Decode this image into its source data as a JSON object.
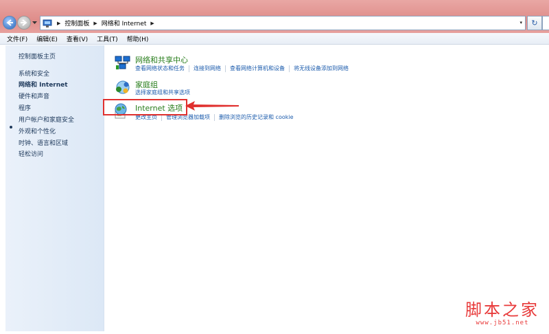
{
  "address": {
    "breadcrumb": [
      "控制面板",
      "网络和 Internet"
    ],
    "dropdown_glyph": "▾",
    "refresh_glyph": "↻"
  },
  "menu": [
    "文件(F)",
    "编辑(E)",
    "查看(V)",
    "工具(T)",
    "帮助(H)"
  ],
  "sidebar": {
    "items": [
      {
        "label": "控制面板主页",
        "active": false
      },
      {
        "label": "系统和安全",
        "active": false
      },
      {
        "label": "网络和 Internet",
        "active": true
      },
      {
        "label": "硬件和声音",
        "active": false
      },
      {
        "label": "程序",
        "active": false
      },
      {
        "label": "用户帐户和家庭安全",
        "active": false
      },
      {
        "label": "外观和个性化",
        "active": false
      },
      {
        "label": "时钟、语言和区域",
        "active": false
      },
      {
        "label": "轻松访问",
        "active": false
      }
    ]
  },
  "categories": [
    {
      "icon": "network-sharing-center-icon",
      "title": "网络和共享中心",
      "links": [
        "查看网络状态和任务",
        "连接到网络",
        "查看网络计算机和设备",
        "将无线设备添加到网络"
      ]
    },
    {
      "icon": "homegroup-icon",
      "title": "家庭组",
      "links": [
        "选择家庭组和共享选项"
      ]
    },
    {
      "icon": "internet-options-icon",
      "title": "Internet 选项",
      "links": [
        "更改主页",
        "管理浏览器加载项",
        "删除浏览的历史记录和 cookie"
      ]
    }
  ],
  "annotation": {
    "highlight_color": "#e0302e",
    "highlighted": "Internet 选项"
  },
  "watermark": {
    "logo": "脚本之家",
    "url": "www.jb51.net"
  }
}
